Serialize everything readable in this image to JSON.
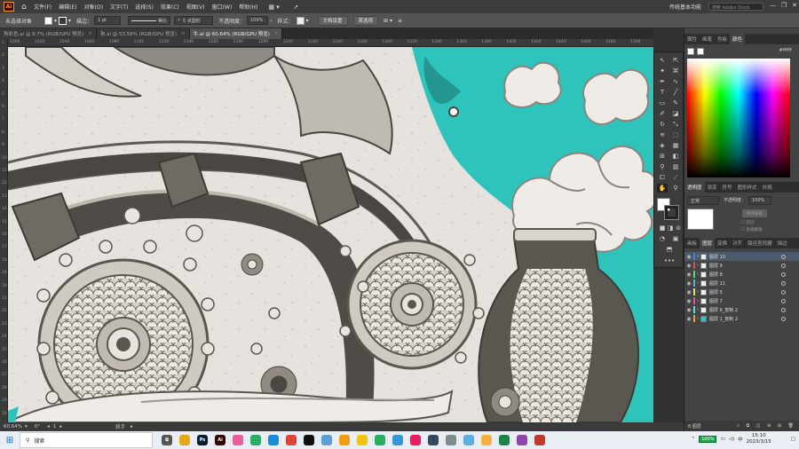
{
  "app": {
    "logo": "Ai",
    "home_icon": "home-icon"
  },
  "menu": {
    "items": [
      "文件(F)",
      "编辑(E)",
      "对象(O)",
      "文字(T)",
      "选择(S)",
      "效果(C)",
      "视图(V)",
      "窗口(W)",
      "帮助(H)"
    ],
    "workspace": "传统基本功能",
    "search_placeholder": "搜索 Adobe Stock"
  },
  "control_bar": {
    "selection": "未选择对象",
    "stroke_label": "描边：",
    "stroke_weight": "1 pt",
    "stroke_style": "等比",
    "brush": "5 点圆形",
    "opacity_label": "不透明度：",
    "opacity": "100%",
    "style_label": "样式：",
    "doc_settings": "文档设置",
    "preferences": "首选项"
  },
  "tabs": [
    {
      "label": "狗彩色.ai @ 9.7% (RGB/GPU 预览)",
      "active": false
    },
    {
      "label": "狗.ai @ 53.56% (RGB/GPU 预览)",
      "active": false
    },
    {
      "label": "牛.ai @ 60.64% (RGB/GPU 预览)",
      "active": true
    }
  ],
  "rulers": {
    "h": [
      "1000",
      "1020",
      "1040",
      "1060",
      "1080",
      "1100",
      "1120",
      "1140",
      "1160",
      "1180",
      "1200",
      "1220",
      "1240",
      "1260",
      "1280",
      "1300",
      "1320",
      "1340",
      "1360",
      "1380",
      "1400",
      "1420",
      "1440",
      "1460",
      "1480",
      "1500"
    ],
    "v": [
      "1",
      "2",
      "3",
      "4",
      "5",
      "6",
      "7",
      "8",
      "9",
      "10",
      "11",
      "12",
      "13",
      "14",
      "15",
      "16",
      "17",
      "18",
      "19",
      "20",
      "21",
      "22",
      "23",
      "24",
      "25",
      "26",
      "27",
      "28",
      "29",
      "30"
    ]
  },
  "status_bar": {
    "zoom": "60.64%",
    "rotation": "0°",
    "artboard": "1",
    "tool": "抓手"
  },
  "panels": {
    "color_tabs": [
      "属性",
      "画笔",
      "色板",
      "颜色"
    ],
    "color_hex": "ffffff",
    "transparency_tabs": [
      "透明度",
      "渐变",
      "符号",
      "图形样式",
      "外观"
    ],
    "blend_mode": "正常",
    "opacity_label": "不透明度：",
    "opacity": "100%",
    "mask_button": "制作蒙版",
    "clip": "剪切",
    "invert_mask": "反相蒙版",
    "layers_tabs": [
      "画板",
      "图层",
      "变换",
      "对齐",
      "路径查找器",
      "描边"
    ],
    "layers": [
      {
        "name": "图层 10",
        "color": "#4f7be2",
        "selected": true
      },
      {
        "name": "图层 9",
        "color": "#e24f4f",
        "selected": false
      },
      {
        "name": "图层 8",
        "color": "#4fe27b",
        "selected": false
      },
      {
        "name": "图层 11",
        "color": "#4fb0e2",
        "selected": false
      },
      {
        "name": "图层 5",
        "color": "#e2e24f",
        "selected": false
      },
      {
        "name": "图层 7",
        "color": "#e24fb0",
        "selected": false
      },
      {
        "name": "图层 6_复制 2",
        "color": "#4fe2e2",
        "selected": false
      },
      {
        "name": "图层 1_复制 2",
        "color": "#e2a24f",
        "selected": false
      }
    ],
    "layers_count": "8 图层"
  },
  "taskbar": {
    "search": "搜索",
    "battery": "100%",
    "time": "15:10",
    "date": "2023/3/15",
    "apps": [
      {
        "name": "task-view",
        "color": "#555",
        "label": "⧉"
      },
      {
        "name": "file-explorer",
        "color": "#e6a817",
        "label": ""
      },
      {
        "name": "photoshop",
        "color": "#001e36",
        "label": "Ps"
      },
      {
        "name": "illustrator",
        "color": "#330000",
        "label": "Ai"
      },
      {
        "name": "app-colorful",
        "color": "#e85c9a",
        "label": ""
      },
      {
        "name": "wechat",
        "color": "#2aae67",
        "label": ""
      },
      {
        "name": "edge",
        "color": "#1b8ad8",
        "label": ""
      },
      {
        "name": "chrome",
        "color": "#db4437",
        "label": ""
      },
      {
        "name": "qq",
        "color": "#111",
        "label": ""
      },
      {
        "name": "network",
        "color": "#5a9fd8",
        "label": ""
      },
      {
        "name": "app-orange",
        "color": "#f39c12",
        "label": ""
      },
      {
        "name": "app-yellow",
        "color": "#f1c40f",
        "label": ""
      },
      {
        "name": "app-green",
        "color": "#27ae60",
        "label": ""
      },
      {
        "name": "app-blue",
        "color": "#3498db",
        "label": ""
      },
      {
        "name": "app-pink",
        "color": "#e91e63",
        "label": ""
      },
      {
        "name": "app-dark",
        "color": "#34495e",
        "label": ""
      },
      {
        "name": "app-gray",
        "color": "#7f8c8d",
        "label": ""
      },
      {
        "name": "app-bird",
        "color": "#5dade2",
        "label": ""
      },
      {
        "name": "app-round",
        "color": "#f5b041",
        "label": ""
      },
      {
        "name": "app-wechat2",
        "color": "#1e8449",
        "label": ""
      },
      {
        "name": "app-purple",
        "color": "#8e44ad",
        "label": ""
      },
      {
        "name": "app-red",
        "color": "#c0392b",
        "label": ""
      }
    ]
  }
}
